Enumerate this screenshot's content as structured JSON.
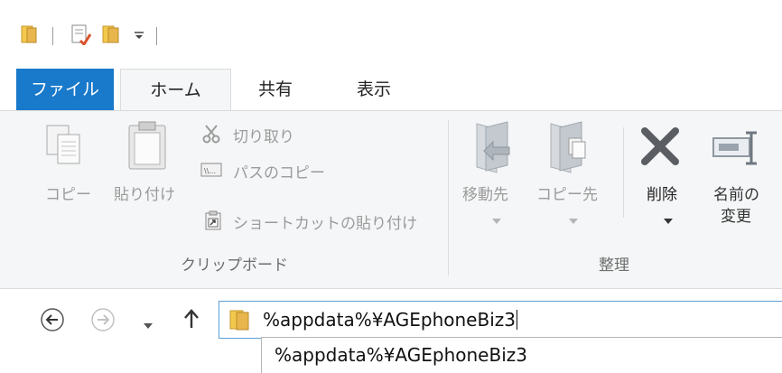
{
  "quick_access": {
    "icons": [
      "folder-icon",
      "properties-icon",
      "new-folder-icon",
      "customize-dropdown-icon"
    ]
  },
  "tabs": [
    {
      "label": "ファイル"
    },
    {
      "label": "ホーム"
    },
    {
      "label": "共有"
    },
    {
      "label": "表示"
    }
  ],
  "ribbon": {
    "clipboard": {
      "copy_label": "コピー",
      "paste_label": "貼り付け",
      "cut_label": "切り取り",
      "copy_path_label": "パスのコピー",
      "paste_shortcut_label": "ショートカットの貼り付け",
      "group_label": "クリップボード"
    },
    "organize": {
      "move_to_label": "移動先",
      "copy_to_label": "コピー先",
      "delete_label": "削除",
      "rename_label_line1": "名前の",
      "rename_label_line2": "変更",
      "group_label": "整理"
    }
  },
  "address_bar": {
    "value": "%appdata%¥AGEphoneBiz3"
  },
  "autocomplete": {
    "items": [
      "%appdata%¥AGEphoneBiz3"
    ]
  },
  "colors": {
    "file_tab": "#1979ca",
    "ribbon_bg": "#f5f6f7",
    "address_border": "#5c9fd6",
    "folder_yellow": "#e8b64c"
  }
}
